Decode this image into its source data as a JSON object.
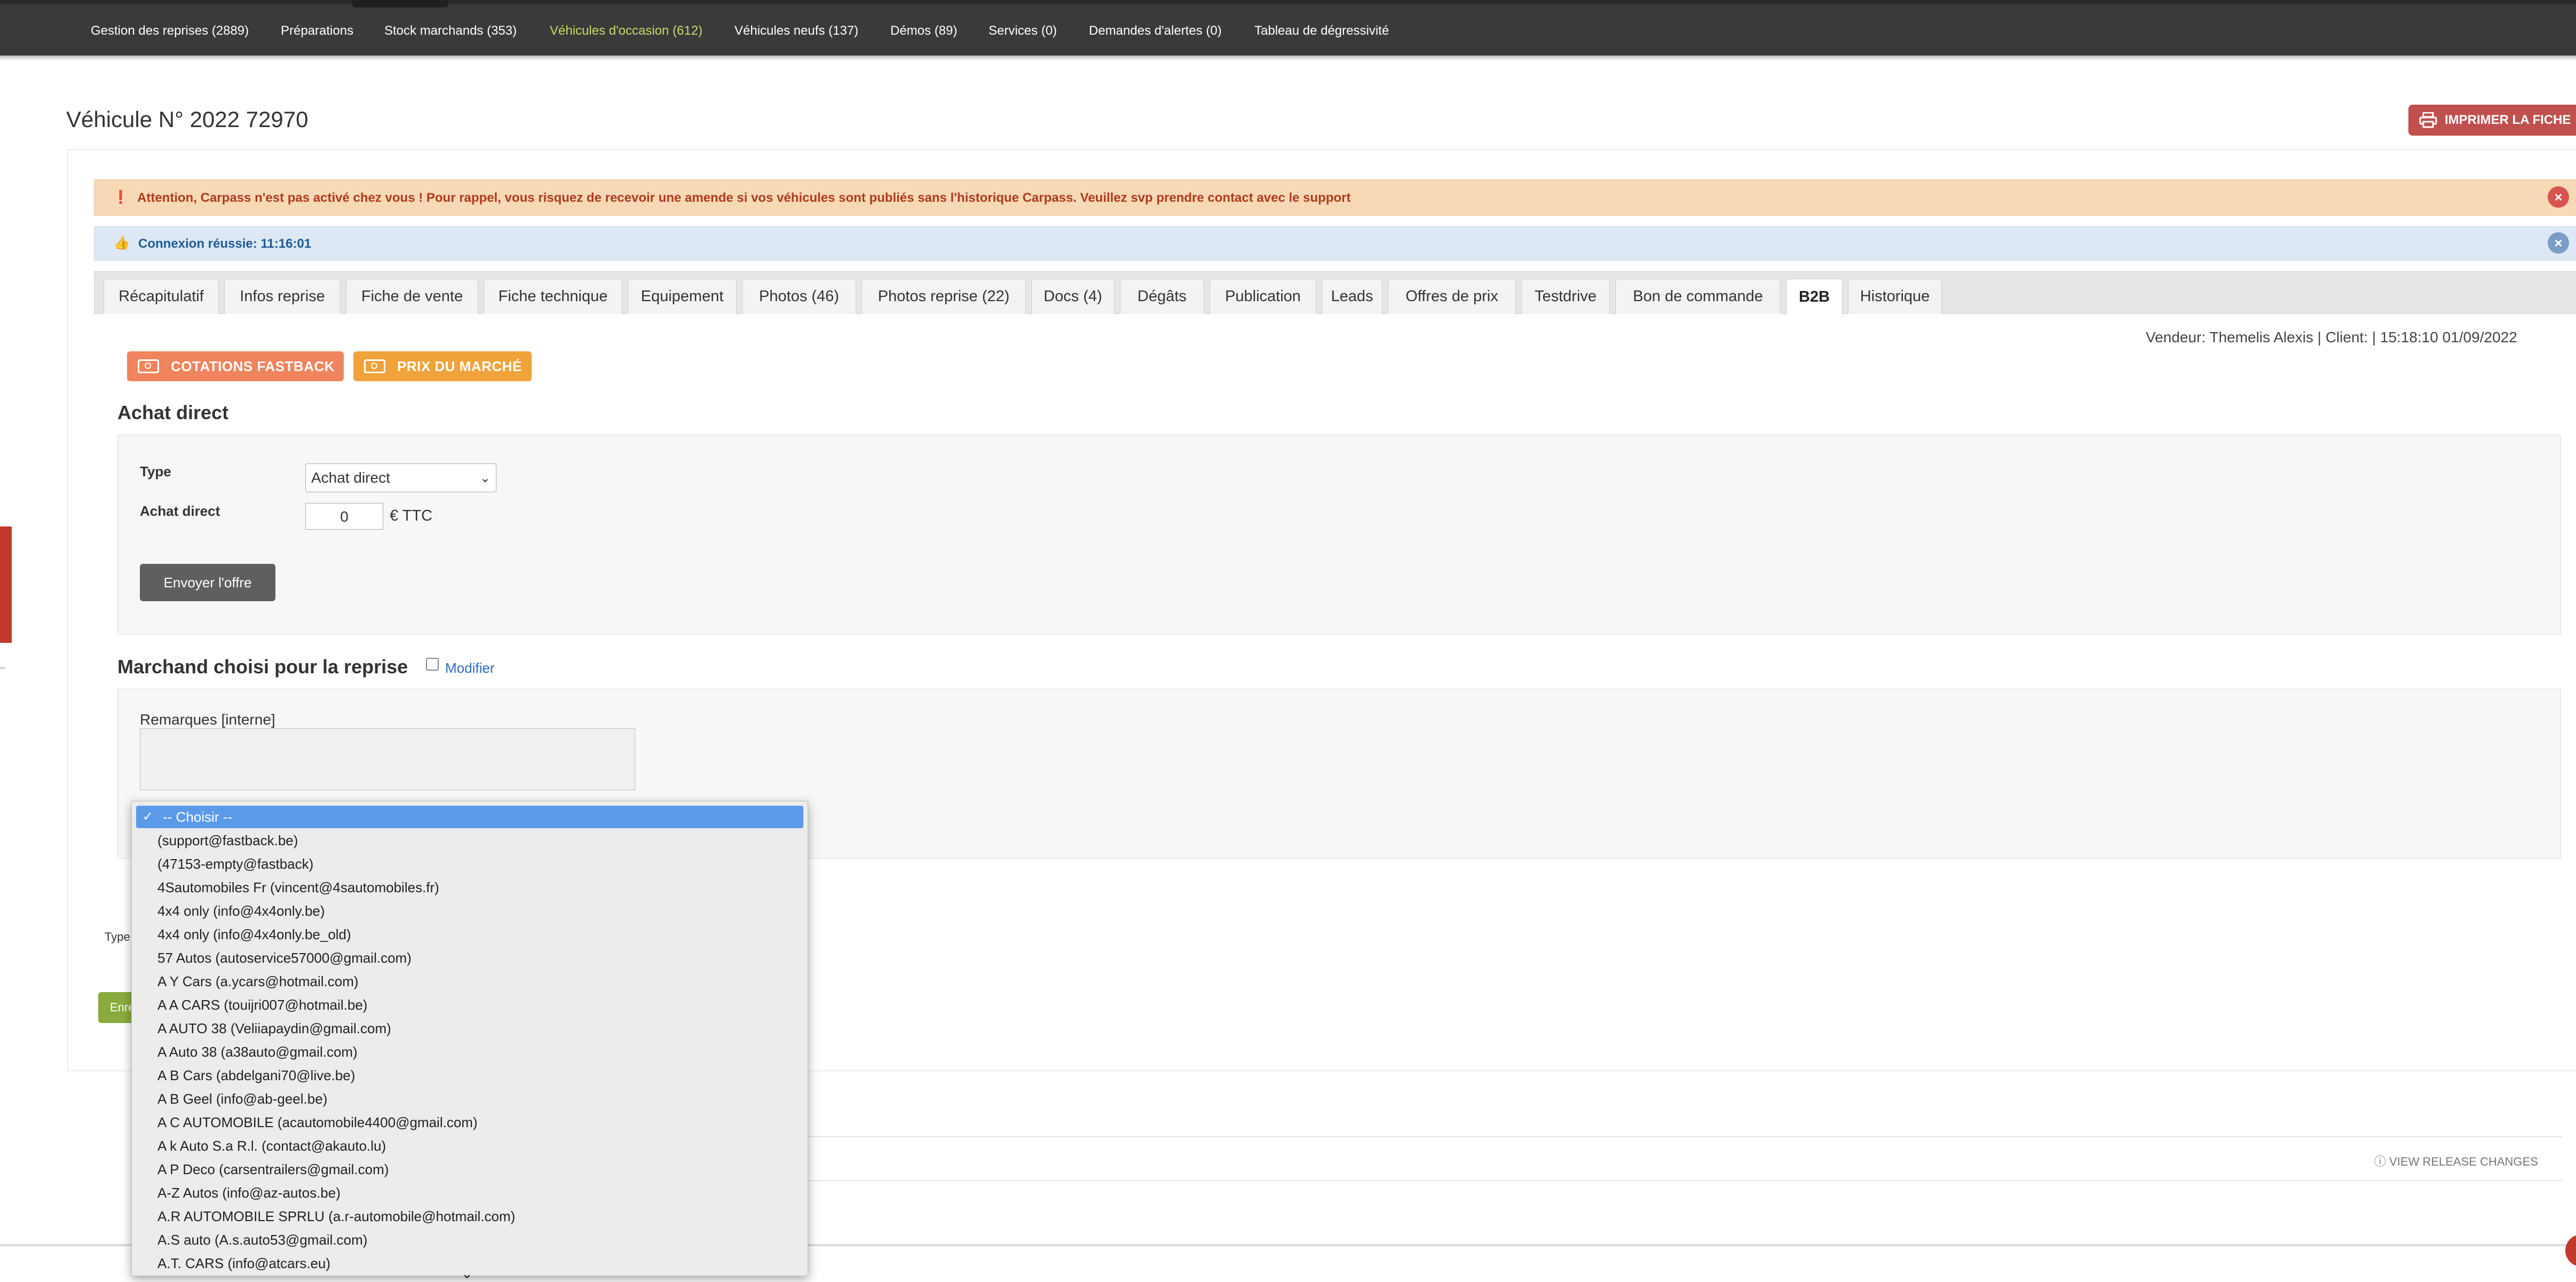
{
  "nav": {
    "items": [
      "Gestion des reprises (2889)",
      "Préparations",
      "Stock marchands (353)",
      "Véhicules d'occasion (612)",
      "Véhicules neufs (137)",
      "Démos (89)",
      "Services (0)",
      "Demandes d'alertes (0)",
      "Tableau de dégressivité"
    ],
    "active": "Véhicules d'occasion (612)"
  },
  "page": {
    "title": "Véhicule N° 2022 72970",
    "print_label": "IMPRIMER LA FICHE"
  },
  "alerts": {
    "carpass": "Attention, Carpass n'est pas activé chez vous ! Pour rappel, vous risquez de recevoir une amende si vos véhicules sont publiés sans l'historique Carpass. Veuillez svp prendre contact avec le support",
    "login": "Connexion réussie: 11:16:01"
  },
  "tabs": [
    "Récapitulatif",
    "Infos reprise",
    "Fiche de vente",
    "Fiche technique",
    "Equipement",
    "Photos (46)",
    "Photos reprise (22)",
    "Docs (4)",
    "Dégâts",
    "Publication",
    "Leads",
    "Offres de prix",
    "Testdrive",
    "Bon de commande",
    "B2B",
    "Historique"
  ],
  "active_tab": "B2B",
  "vendeur_line": "Vendeur: Themelis Alexis | Client: | 15:18:10 01/09/2022",
  "buttons": {
    "cotations": "COTATIONS FASTBACK",
    "prix_marche": "PRIX DU MARCHÉ",
    "envoyer": "Envoyer l'offre"
  },
  "achat": {
    "title": "Achat direct",
    "type_label": "Type",
    "type_value": "Achat direct",
    "achat_label": "Achat direct",
    "achat_value": "0",
    "unit": "€ TTC"
  },
  "marchand": {
    "title": "Marchand choisi pour la reprise",
    "modifier": "Modifier",
    "remarques_label": "Remarques [interne]"
  },
  "lower": {
    "type_label": "Type",
    "button_fragment": "Enre"
  },
  "footer": {
    "release": "VIEW RELEASE CHANGES"
  },
  "dropdown": {
    "selected": "-- Choisir --",
    "options": [
      "(support@fastback.be)",
      "(47153-empty@fastback)",
      "4Sautomobiles Fr (vincent@4sautomobiles.fr)",
      "4x4 only (info@4x4only.be)",
      "4x4 only (info@4x4only.be_old)",
      "57 Autos (autoservice57000@gmail.com)",
      "A Y Cars (a.ycars@hotmail.com)",
      "A A CARS (touijri007@hotmail.be)",
      "A AUTO 38 (Veliiapaydin@gmail.com)",
      "A Auto 38 (a38auto@gmail.com)",
      "A B Cars (abdelgani70@live.be)",
      "A B Geel (info@ab-geel.be)",
      "A C AUTOMOBILE (acautomobile4400@gmail.com)",
      "A k Auto S.a R.l. (contact@akauto.lu)",
      "A P Deco (carsentrailers@gmail.com)",
      "A-Z Autos (info@az-autos.be)",
      "A.R AUTOMOBILE SPRLU (a.r-automobile@hotmail.com)",
      "A.S auto (A.s.auto53@gmail.com)",
      "A.T. CARS (info@atcars.eu)"
    ]
  },
  "colors": {
    "nav_bg": "#3a3a3a",
    "nav_active": "#c9d86a",
    "print_btn": "#c0504d",
    "orange_btn": "#f0845c",
    "orange_btn2": "#f0a33a",
    "alert_bg": "#f7d9b6",
    "alert_text": "#b03a1e",
    "info_text": "#1d5a96",
    "dropdown_selected": "#5b9ae8"
  },
  "icons": {
    "print": "printer-icon",
    "alert": "exclamation-circle-icon",
    "login": "thumbs-up-icon",
    "close": "close-icon",
    "cash": "money-icon",
    "release": "info-icon"
  }
}
